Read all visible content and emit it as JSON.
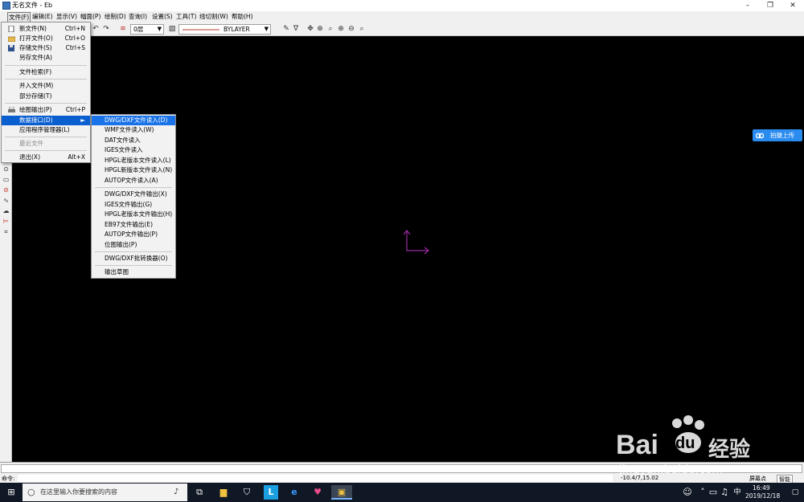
{
  "window": {
    "title": "无名文件 - Eb",
    "min": "–",
    "max": "❐",
    "close": "✕"
  },
  "menubar": {
    "items": [
      "文件(F)",
      "编辑(E)",
      "显示(V)",
      "幅面(P)",
      "绘制(D)",
      "查询(I)",
      "设置(S)",
      "工具(T)",
      "线切割(W)",
      "帮助(H)"
    ]
  },
  "toolbar": {
    "layer_value": "0层",
    "linetype_value": "BYLAYER"
  },
  "file_menu": {
    "items": [
      {
        "label": "新文件(N)",
        "shortcut": "Ctrl+N"
      },
      {
        "label": "打开文件(O)",
        "shortcut": "Ctrl+O"
      },
      {
        "label": "存储文件(S)",
        "shortcut": "Ctrl+S"
      },
      {
        "label": "另存文件(A)",
        "shortcut": ""
      },
      {
        "label": "文件检索(F)",
        "shortcut": ""
      },
      {
        "label": "并入文件(M)",
        "shortcut": ""
      },
      {
        "label": "部分存储(T)",
        "shortcut": ""
      },
      {
        "label": "绘图输出(P)",
        "shortcut": "Ctrl+P"
      },
      {
        "label": "数据接口(D)",
        "shortcut": "►"
      },
      {
        "label": "应用程序管理器(L)",
        "shortcut": ""
      },
      {
        "label": "最近文件",
        "shortcut": ""
      },
      {
        "label": "退出(X)",
        "shortcut": "Alt+X"
      }
    ]
  },
  "data_submenu": {
    "items": [
      "DWG/DXF文件读入(D)",
      "WMF文件读入(W)",
      "DAT文件读入",
      "IGES文件读入",
      "HPGL老版本文件读入(L)",
      "HPGL新版本文件读入(N)",
      "AUTOP文件读入(A)",
      "DWG/DXF文件输出(X)",
      "IGES文件输出(G)",
      "HPGL老版本文件输出(H)",
      "EB97文件输出(E)",
      "AUTOP文件输出(P)",
      "位图输出(P)",
      "DWG/DXF批转换器(O)",
      "输出草图"
    ]
  },
  "upload_button": {
    "label": "拍摄上传"
  },
  "command_bar": {
    "prompt": "命令:"
  },
  "status": {
    "coords": "-10.4/7,15.02",
    "snap": "智能",
    "snap_mode": "屏幕点"
  },
  "taskbar": {
    "search_placeholder": "在这里输入你要搜索的内容",
    "time": "16:49",
    "date": "2019/12/18",
    "ime": "中"
  },
  "watermark": {
    "brand": "Bai",
    "brand2": "du",
    "cn": "经验",
    "url": "jingyan.baidu.com"
  },
  "colors": {
    "menu_highlight": "#0a5fd0",
    "canvas": "#000000",
    "axis": "#9b2aa0",
    "arrow": "#e8192c",
    "upload": "#2b8cf0"
  }
}
